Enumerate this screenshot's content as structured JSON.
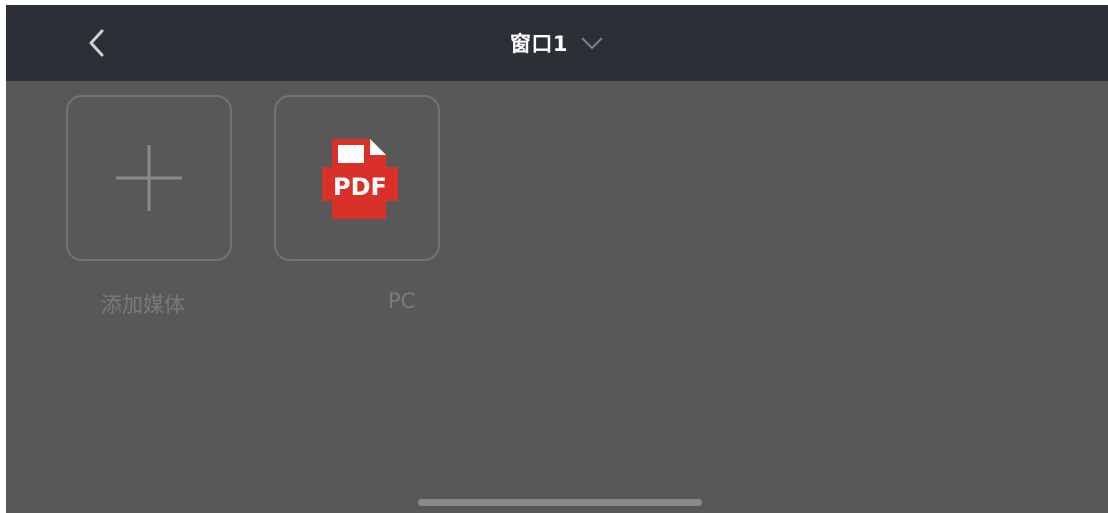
{
  "navbar": {
    "back_icon": "chevron-left-icon",
    "title": "窗口1",
    "title_dropdown_icon": "chevron-down-icon"
  },
  "media_items": [
    {
      "icon": "plus-icon",
      "label": "添加媒体"
    },
    {
      "icon": "pdf-file-icon",
      "icon_text": "PDF",
      "label": "PC"
    }
  ],
  "colors": {
    "navbar_bg": "#2d2f36",
    "content_bg": "#585858",
    "pdf_red": "#d9302a"
  }
}
